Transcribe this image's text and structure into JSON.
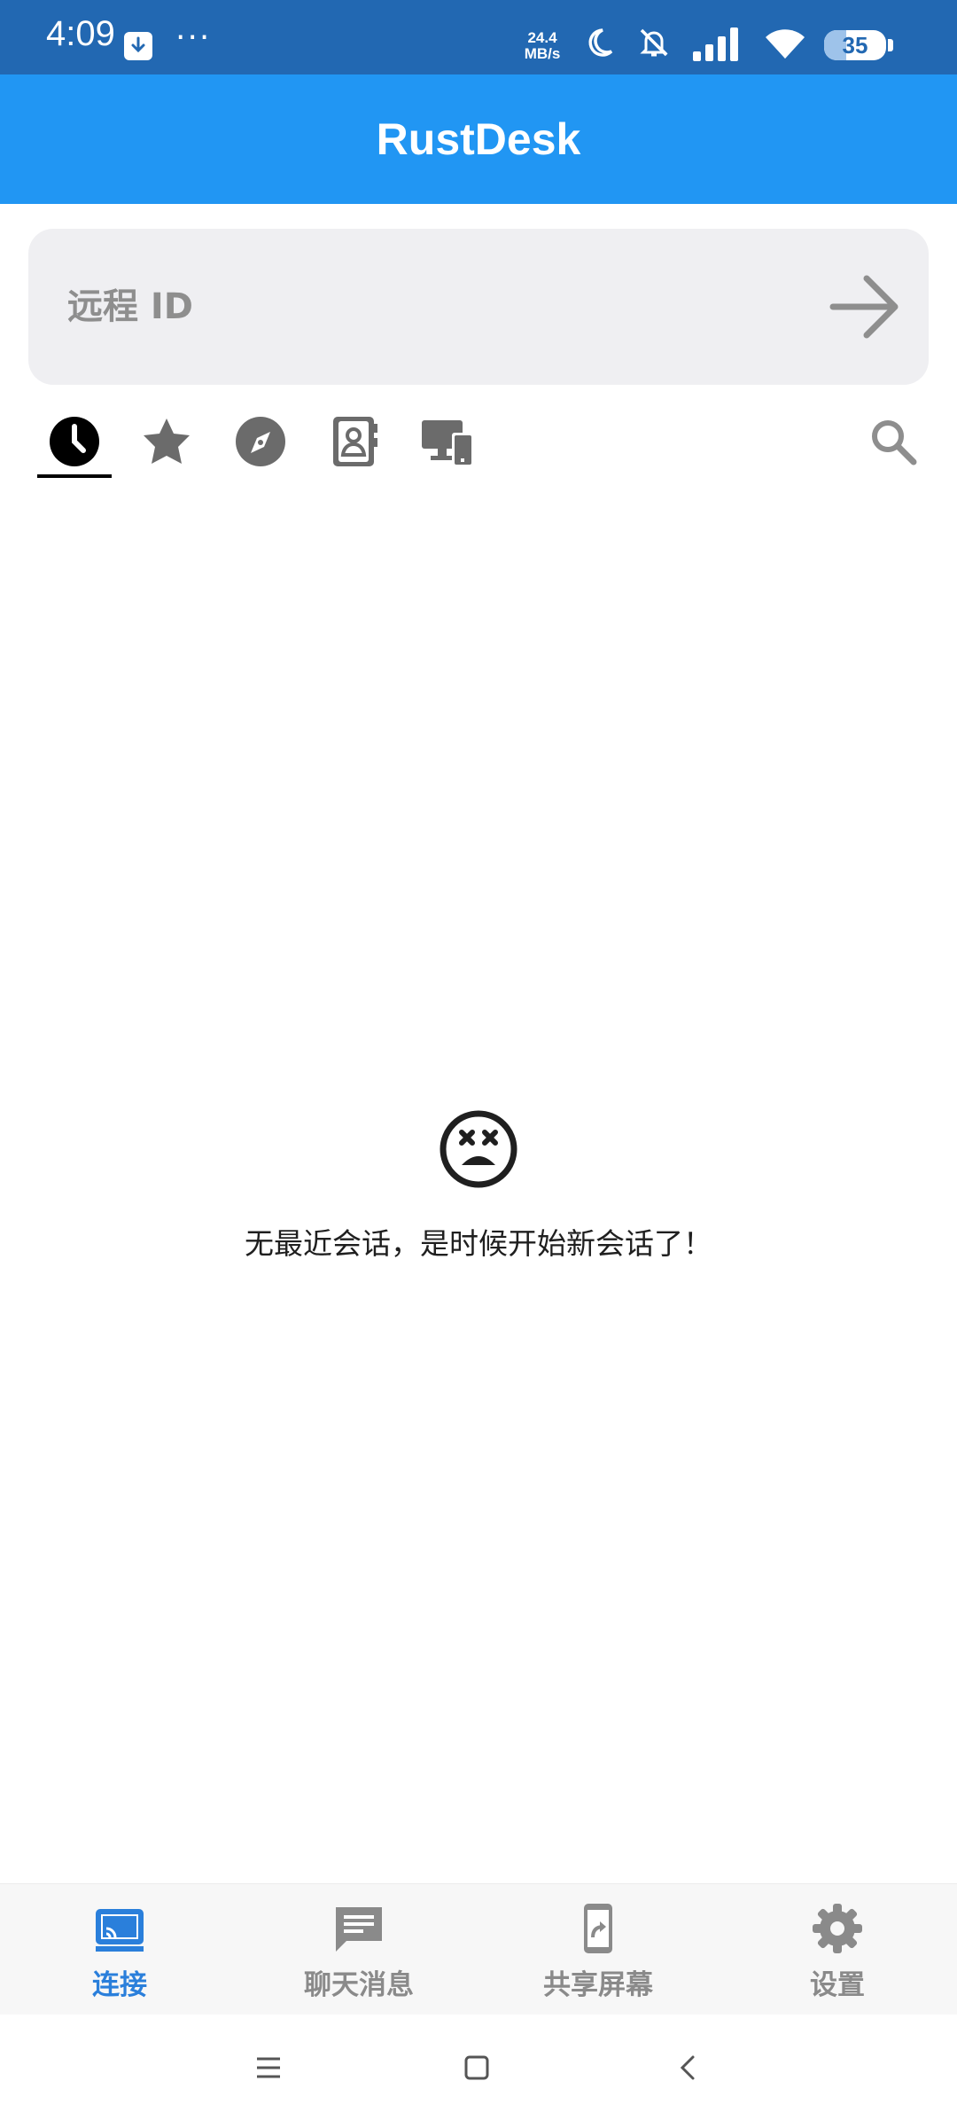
{
  "status_bar": {
    "time": "4:09",
    "more": "···",
    "net_speed_value": "24.4",
    "net_speed_unit": "MB/s",
    "battery_level": "35",
    "icons": [
      "download-icon",
      "moon-icon",
      "bell-off-icon",
      "signal-icon",
      "wifi-icon",
      "battery-icon"
    ]
  },
  "app_bar": {
    "title": "RustDesk"
  },
  "remote": {
    "placeholder": "远程 ID",
    "go_icon": "arrow-right-icon"
  },
  "tabs": [
    {
      "icon": "clock-icon",
      "selected": true
    },
    {
      "icon": "star-icon",
      "selected": false
    },
    {
      "icon": "compass-icon",
      "selected": false
    },
    {
      "icon": "address-book-icon",
      "selected": false
    },
    {
      "icon": "devices-icon",
      "selected": false
    }
  ],
  "search_icon": "search-icon",
  "empty_state": {
    "icon": "dizzy-face-icon",
    "message": "无最近会话，是时候开始新会话了！"
  },
  "bottom_nav": {
    "items": [
      {
        "label": "连接",
        "icon": "cast-icon",
        "active": true
      },
      {
        "label": "聊天消息",
        "icon": "chat-icon",
        "active": false
      },
      {
        "label": "共享屏幕",
        "icon": "screen-share-icon",
        "active": false
      },
      {
        "label": "设置",
        "icon": "gear-icon",
        "active": false
      }
    ]
  },
  "colors": {
    "status_bar": "#2268b2",
    "app_bar": "#2196f3",
    "active_nav": "#2a7fdb",
    "inactive": "#8a8a8a",
    "input_bg": "#efeff2"
  }
}
